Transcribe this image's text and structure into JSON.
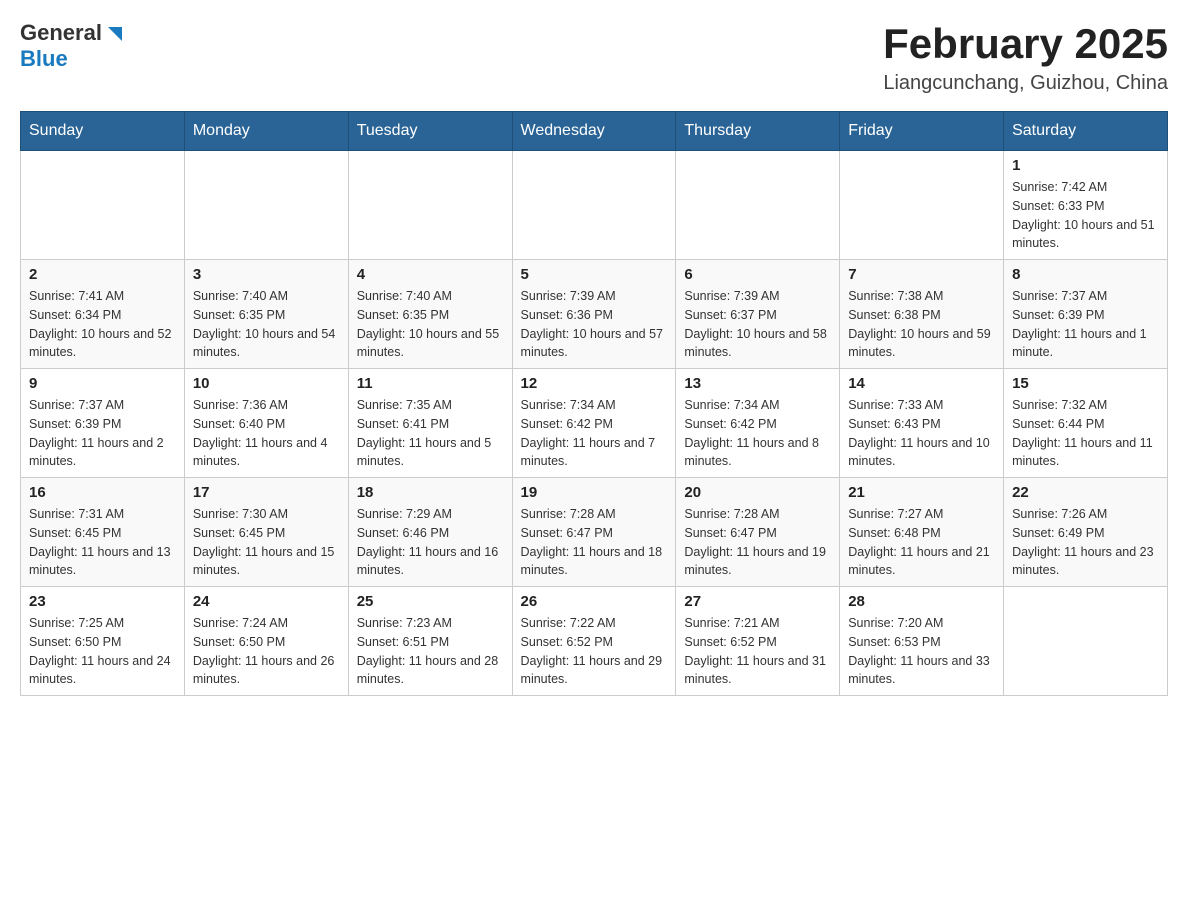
{
  "logo": {
    "general": "General",
    "blue": "Blue"
  },
  "header": {
    "title": "February 2025",
    "subtitle": "Liangcunchang, Guizhou, China"
  },
  "weekdays": [
    "Sunday",
    "Monday",
    "Tuesday",
    "Wednesday",
    "Thursday",
    "Friday",
    "Saturday"
  ],
  "weeks": [
    [
      {
        "day": "",
        "sunrise": "",
        "sunset": "",
        "daylight": ""
      },
      {
        "day": "",
        "sunrise": "",
        "sunset": "",
        "daylight": ""
      },
      {
        "day": "",
        "sunrise": "",
        "sunset": "",
        "daylight": ""
      },
      {
        "day": "",
        "sunrise": "",
        "sunset": "",
        "daylight": ""
      },
      {
        "day": "",
        "sunrise": "",
        "sunset": "",
        "daylight": ""
      },
      {
        "day": "",
        "sunrise": "",
        "sunset": "",
        "daylight": ""
      },
      {
        "day": "1",
        "sunrise": "Sunrise: 7:42 AM",
        "sunset": "Sunset: 6:33 PM",
        "daylight": "Daylight: 10 hours and 51 minutes."
      }
    ],
    [
      {
        "day": "2",
        "sunrise": "Sunrise: 7:41 AM",
        "sunset": "Sunset: 6:34 PM",
        "daylight": "Daylight: 10 hours and 52 minutes."
      },
      {
        "day": "3",
        "sunrise": "Sunrise: 7:40 AM",
        "sunset": "Sunset: 6:35 PM",
        "daylight": "Daylight: 10 hours and 54 minutes."
      },
      {
        "day": "4",
        "sunrise": "Sunrise: 7:40 AM",
        "sunset": "Sunset: 6:35 PM",
        "daylight": "Daylight: 10 hours and 55 minutes."
      },
      {
        "day": "5",
        "sunrise": "Sunrise: 7:39 AM",
        "sunset": "Sunset: 6:36 PM",
        "daylight": "Daylight: 10 hours and 57 minutes."
      },
      {
        "day": "6",
        "sunrise": "Sunrise: 7:39 AM",
        "sunset": "Sunset: 6:37 PM",
        "daylight": "Daylight: 10 hours and 58 minutes."
      },
      {
        "day": "7",
        "sunrise": "Sunrise: 7:38 AM",
        "sunset": "Sunset: 6:38 PM",
        "daylight": "Daylight: 10 hours and 59 minutes."
      },
      {
        "day": "8",
        "sunrise": "Sunrise: 7:37 AM",
        "sunset": "Sunset: 6:39 PM",
        "daylight": "Daylight: 11 hours and 1 minute."
      }
    ],
    [
      {
        "day": "9",
        "sunrise": "Sunrise: 7:37 AM",
        "sunset": "Sunset: 6:39 PM",
        "daylight": "Daylight: 11 hours and 2 minutes."
      },
      {
        "day": "10",
        "sunrise": "Sunrise: 7:36 AM",
        "sunset": "Sunset: 6:40 PM",
        "daylight": "Daylight: 11 hours and 4 minutes."
      },
      {
        "day": "11",
        "sunrise": "Sunrise: 7:35 AM",
        "sunset": "Sunset: 6:41 PM",
        "daylight": "Daylight: 11 hours and 5 minutes."
      },
      {
        "day": "12",
        "sunrise": "Sunrise: 7:34 AM",
        "sunset": "Sunset: 6:42 PM",
        "daylight": "Daylight: 11 hours and 7 minutes."
      },
      {
        "day": "13",
        "sunrise": "Sunrise: 7:34 AM",
        "sunset": "Sunset: 6:42 PM",
        "daylight": "Daylight: 11 hours and 8 minutes."
      },
      {
        "day": "14",
        "sunrise": "Sunrise: 7:33 AM",
        "sunset": "Sunset: 6:43 PM",
        "daylight": "Daylight: 11 hours and 10 minutes."
      },
      {
        "day": "15",
        "sunrise": "Sunrise: 7:32 AM",
        "sunset": "Sunset: 6:44 PM",
        "daylight": "Daylight: 11 hours and 11 minutes."
      }
    ],
    [
      {
        "day": "16",
        "sunrise": "Sunrise: 7:31 AM",
        "sunset": "Sunset: 6:45 PM",
        "daylight": "Daylight: 11 hours and 13 minutes."
      },
      {
        "day": "17",
        "sunrise": "Sunrise: 7:30 AM",
        "sunset": "Sunset: 6:45 PM",
        "daylight": "Daylight: 11 hours and 15 minutes."
      },
      {
        "day": "18",
        "sunrise": "Sunrise: 7:29 AM",
        "sunset": "Sunset: 6:46 PM",
        "daylight": "Daylight: 11 hours and 16 minutes."
      },
      {
        "day": "19",
        "sunrise": "Sunrise: 7:28 AM",
        "sunset": "Sunset: 6:47 PM",
        "daylight": "Daylight: 11 hours and 18 minutes."
      },
      {
        "day": "20",
        "sunrise": "Sunrise: 7:28 AM",
        "sunset": "Sunset: 6:47 PM",
        "daylight": "Daylight: 11 hours and 19 minutes."
      },
      {
        "day": "21",
        "sunrise": "Sunrise: 7:27 AM",
        "sunset": "Sunset: 6:48 PM",
        "daylight": "Daylight: 11 hours and 21 minutes."
      },
      {
        "day": "22",
        "sunrise": "Sunrise: 7:26 AM",
        "sunset": "Sunset: 6:49 PM",
        "daylight": "Daylight: 11 hours and 23 minutes."
      }
    ],
    [
      {
        "day": "23",
        "sunrise": "Sunrise: 7:25 AM",
        "sunset": "Sunset: 6:50 PM",
        "daylight": "Daylight: 11 hours and 24 minutes."
      },
      {
        "day": "24",
        "sunrise": "Sunrise: 7:24 AM",
        "sunset": "Sunset: 6:50 PM",
        "daylight": "Daylight: 11 hours and 26 minutes."
      },
      {
        "day": "25",
        "sunrise": "Sunrise: 7:23 AM",
        "sunset": "Sunset: 6:51 PM",
        "daylight": "Daylight: 11 hours and 28 minutes."
      },
      {
        "day": "26",
        "sunrise": "Sunrise: 7:22 AM",
        "sunset": "Sunset: 6:52 PM",
        "daylight": "Daylight: 11 hours and 29 minutes."
      },
      {
        "day": "27",
        "sunrise": "Sunrise: 7:21 AM",
        "sunset": "Sunset: 6:52 PM",
        "daylight": "Daylight: 11 hours and 31 minutes."
      },
      {
        "day": "28",
        "sunrise": "Sunrise: 7:20 AM",
        "sunset": "Sunset: 6:53 PM",
        "daylight": "Daylight: 11 hours and 33 minutes."
      },
      {
        "day": "",
        "sunrise": "",
        "sunset": "",
        "daylight": ""
      }
    ]
  ]
}
